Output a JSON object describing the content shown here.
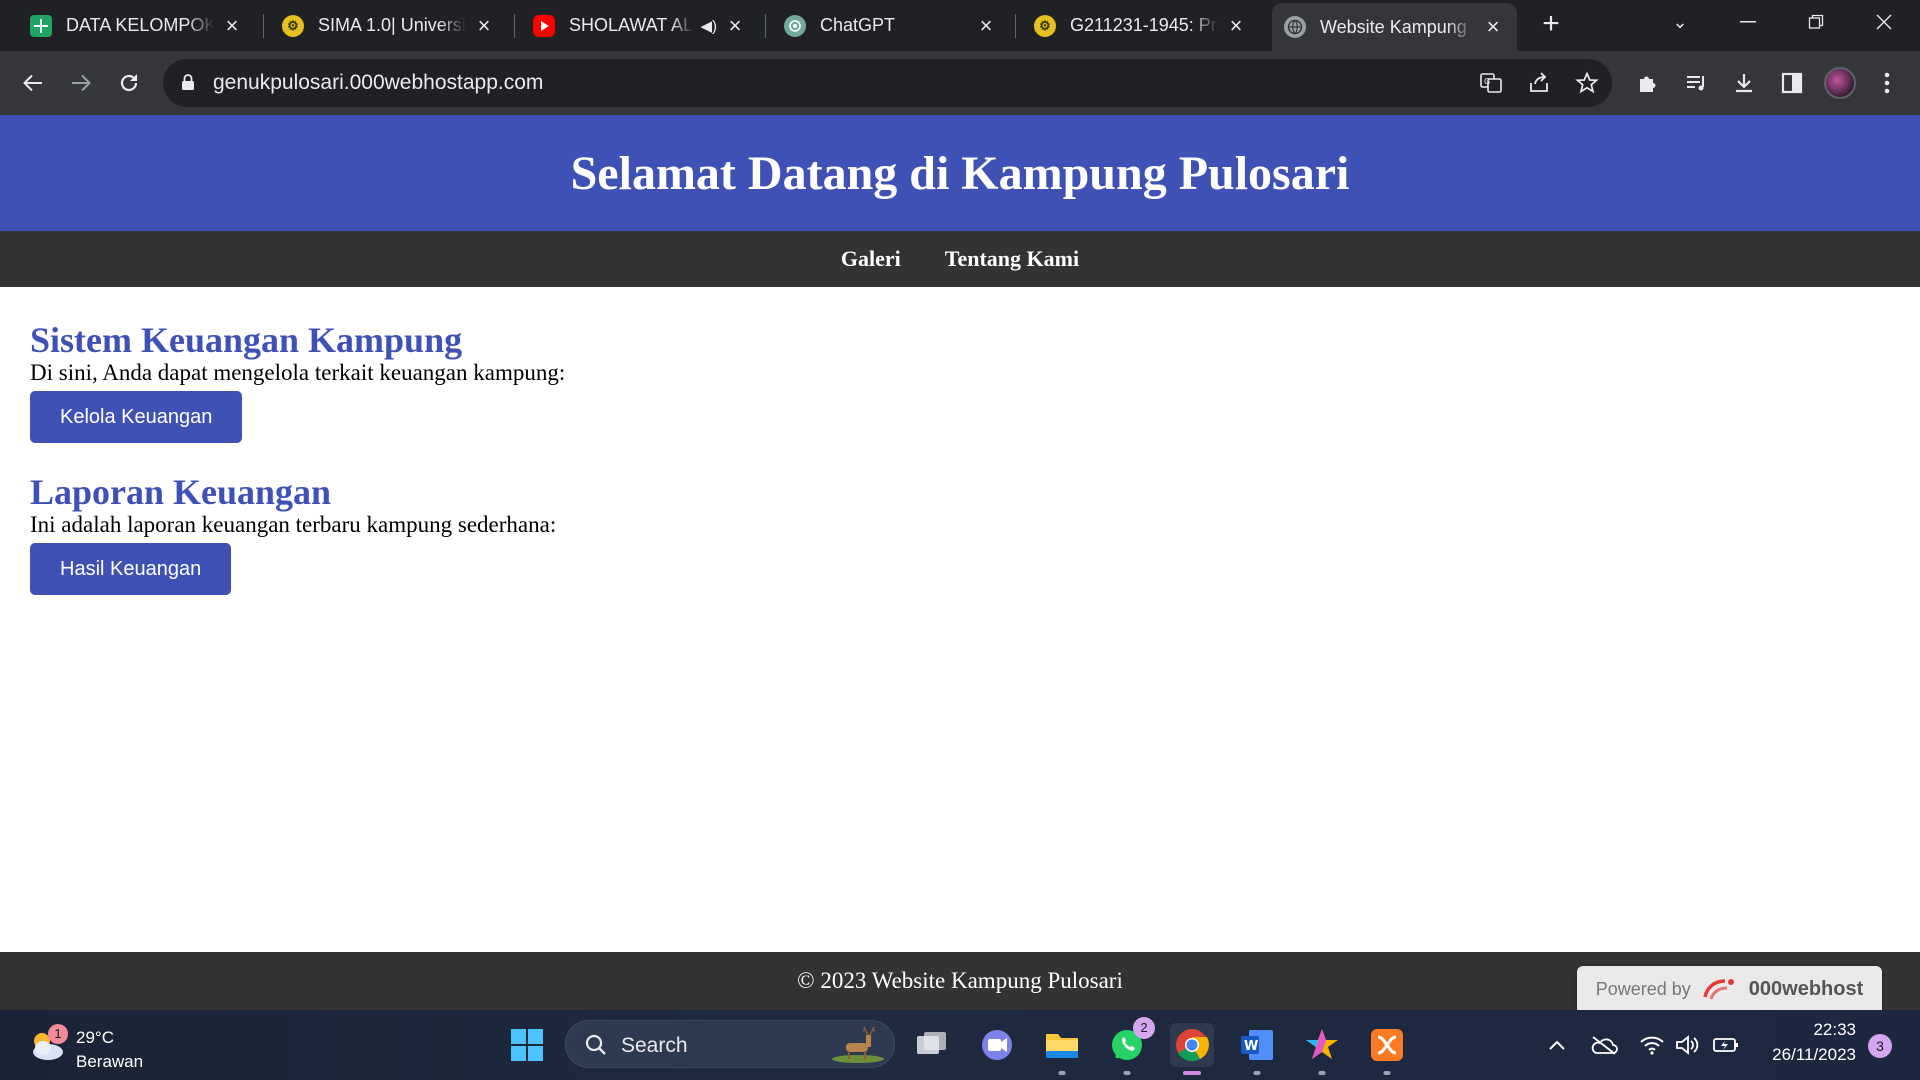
{
  "browser": {
    "tabs": [
      {
        "title": "DATA KELOMPOK I",
        "favicon": "sheets-icon",
        "active": false
      },
      {
        "title": "SIMA 1.0| Universitas",
        "favicon": "university-icon",
        "active": false
      },
      {
        "title": "SHOLAWAT AL",
        "favicon": "youtube-icon",
        "active": false,
        "audio": true
      },
      {
        "title": "ChatGPT",
        "favicon": "chatgpt-icon",
        "active": false
      },
      {
        "title": "G211231-1945: Pro",
        "favicon": "university-icon",
        "active": false
      },
      {
        "title": "Website Kampung",
        "favicon": "globe-icon",
        "active": true
      }
    ],
    "url": "genukpulosari.000webhostapp.com"
  },
  "site": {
    "header_title": "Selamat Datang di Kampung Pulosari",
    "nav": [
      "Galeri",
      "Tentang Kami"
    ],
    "sections": [
      {
        "heading": "Sistem Keuangan Kampung",
        "text": "Di sini, Anda dapat mengelola terkait keuangan kampung:",
        "button": "Kelola Keuangan"
      },
      {
        "heading": "Laporan Keuangan",
        "text": "Ini adalah laporan keuangan terbaru kampung sederhana:",
        "button": "Hasil Keuangan"
      }
    ],
    "footer": "© 2023 Website Kampung Pulosari",
    "powered_by": {
      "prefix": "Powered by",
      "brand": "000webhost"
    },
    "colors": {
      "primary": "#3f51b5",
      "dark": "#333333"
    }
  },
  "taskbar": {
    "weather": {
      "temp": "29°C",
      "condition": "Berawan",
      "badge": "1"
    },
    "search_label": "Search",
    "whatsapp_badge": "2",
    "time": "22:33",
    "date": "26/11/2023",
    "notifications": "3"
  }
}
